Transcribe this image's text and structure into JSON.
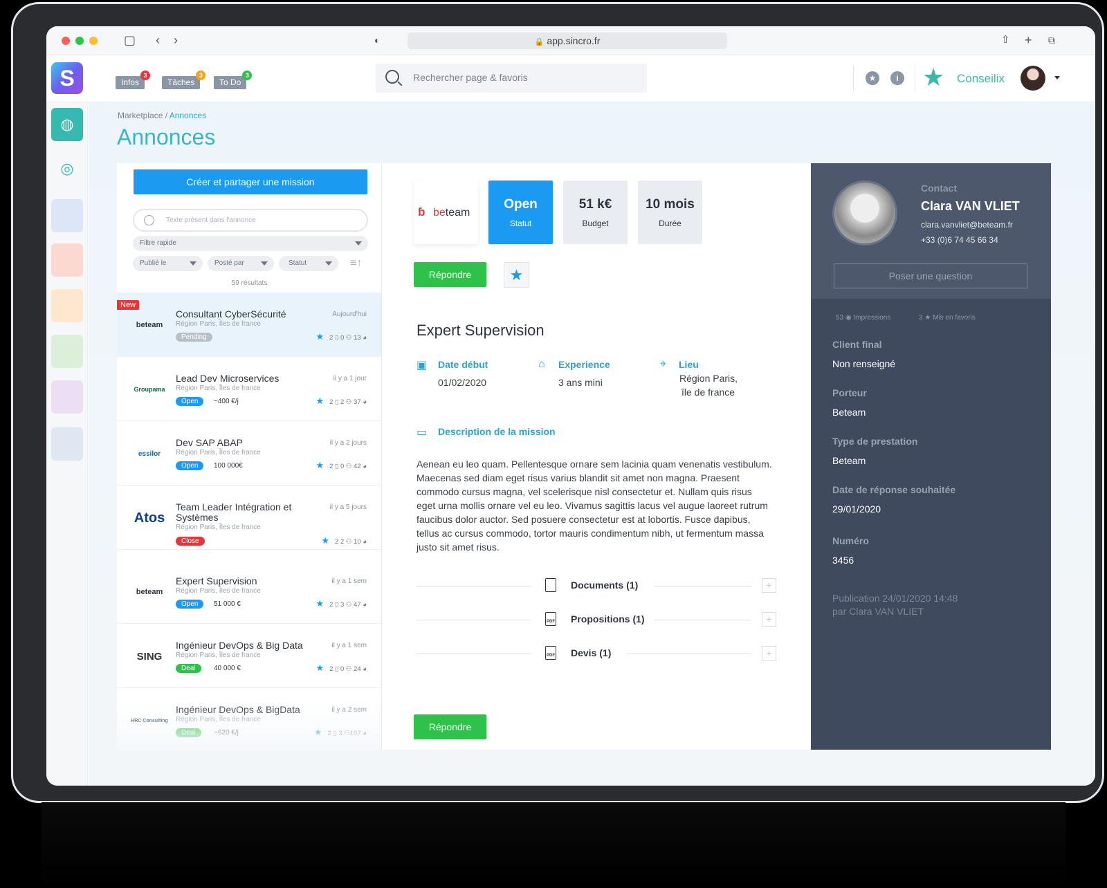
{
  "browser": {
    "url": "app.sincro.fr"
  },
  "app": {
    "logo_letter": "S",
    "tabs": [
      {
        "label": "Infos",
        "badge": "3",
        "badge_color": "#e8353a"
      },
      {
        "label": "Tâches",
        "badge": "3",
        "badge_color": "#f2a51a"
      },
      {
        "label": "To Do",
        "badge": "3",
        "badge_color": "#2ec24a"
      }
    ],
    "search_placeholder": "Rechercher page & favoris",
    "brand": "Conseilix"
  },
  "page": {
    "breadcrumb_root": "Marketplace / ",
    "breadcrumb_active": "Annonces",
    "title": "Annonces"
  },
  "list": {
    "create_button": "Créer et partager une mission",
    "search_placeholder": "Texte présent dans l'annonce",
    "quick_filter": "Filtre rapide",
    "filters": [
      "Publié le",
      "Posté par",
      "Statut"
    ],
    "results": "59 résultats",
    "new_label": "New",
    "items": [
      {
        "company": "beteam",
        "title": "Consultant CyberSécurité",
        "location": "Région Paris, Îles de france",
        "time": "Aujourd'hui",
        "status": "Pending",
        "price": "",
        "stats": "2 ▯ 0 ⚇ 13 ◕"
      },
      {
        "company": "Groupama",
        "title": "Lead Dev Microservices",
        "location": "Région Paris, Îles de france",
        "time": "il y a 1 jour",
        "status": "Open",
        "price": "~400 €/j",
        "stats": "2 ▯ 2 ⚇ 37 ◕"
      },
      {
        "company": "essilor",
        "title": "Dev SAP ABAP",
        "location": "Région Paris, Îles de france",
        "time": "il y a 2 jours",
        "status": "Open",
        "price": "100 000€",
        "stats": "2 ▯ 0 ⚇ 42 ◕"
      },
      {
        "company": "Atos",
        "title": "Team Leader Intégration et Systèmes",
        "location": "Région Paris, Îles de france",
        "time": "il y a 5 jours",
        "status": "Close",
        "price": "",
        "stats": "2 2 ⚇ 10 ◕"
      },
      {
        "company": "beteam",
        "title": "Expert Supervision",
        "location": "Région Paris, Îles de france",
        "time": "il y a 1 sem",
        "status": "Open",
        "price": "51 000 €",
        "stats": "2 ▯ 3 ⚇ 47 ◕"
      },
      {
        "company": "SING",
        "title": "Ingénieur DevOps & Big Data",
        "location": "Région Paris, Îles de france",
        "time": "il y a 1 sem",
        "status": "Deal",
        "price": "40 000 €",
        "stats": "2 ▯ 0 ⚇ 24 ◕"
      },
      {
        "company": "HRC Consulting",
        "title": "Ingénieur DevOps & BigData",
        "location": "Région Paris, Îles de france",
        "time": "il y a 2 sem",
        "status": "Deal",
        "price": "~620 €/j",
        "stats": "2 ▯ 3 ⚇107 ◕"
      }
    ]
  },
  "detail": {
    "company_logo": "beteam",
    "status_value": "Open",
    "status_label": "Statut",
    "budget_value": "51 k€",
    "budget_label": "Budget",
    "duration_value": "10 mois",
    "duration_label": "Durée",
    "reply_button": "Répondre",
    "title": "Expert Supervision",
    "start_label": "Date début",
    "start_value": "01/02/2020",
    "exp_label": "Experience",
    "exp_value": "3 ans mini",
    "place_label": "Lieu",
    "place_value_1": "Région Paris,",
    "place_value_2": "île de france",
    "desc_label": "Description de la mission",
    "description": "Aenean eu leo quam. Pellentesque ornare sem lacinia quam venenatis vestibulum. Maecenas sed diam eget risus varius blandit sit amet non magna. Praesent commodo cursus magna, vel scelerisque nisl consectetur et. Nullam quis risus eget urna mollis ornare vel eu leo. Vivamus sagittis lacus vel augue laoreet rutrum faucibus dolor auctor. Sed posuere consectetur est at lobortis. Fusce dapibus, tellus ac cursus commodo, tortor mauris condimentum nibh, ut fermentum massa justo sit amet risus.",
    "documents": "Documents (1)",
    "propositions": "Propositions (1)",
    "devis": "Devis (1)"
  },
  "contact": {
    "label": "Contact",
    "name": "Clara VAN VLIET",
    "email": "clara.vanvliet@beteam.fr",
    "phone": "+33 (0)6 74 45 66 34",
    "ask_button": "Poser une question",
    "impressions": "53 ◉ Impressions",
    "favorites": "3 ★ Mis en favoris",
    "fields": [
      {
        "key": "Client final",
        "value": "Non renseigné"
      },
      {
        "key": "Porteur",
        "value": "Beteam"
      },
      {
        "key": "Type de prestation",
        "value": "Beteam"
      },
      {
        "key": "Date de réponse souhaitée",
        "value": "29/01/2020"
      },
      {
        "key": "Numéro",
        "value": "3456"
      }
    ],
    "publication_line1": "Publication  24/01/2020 14:48",
    "publication_line2": "par Clara VAN VLIET"
  },
  "colors": {
    "accent": "#39b6c9",
    "primary": "#1a9af0",
    "success": "#2ec24a",
    "danger": "#e8353a",
    "panel_dark": "#3f4a5e"
  },
  "status_colors": {
    "Pending": "#b9c0c8",
    "Open": "#1a9af0",
    "Close": "#e8353a",
    "Deal": "#2ec24a"
  }
}
